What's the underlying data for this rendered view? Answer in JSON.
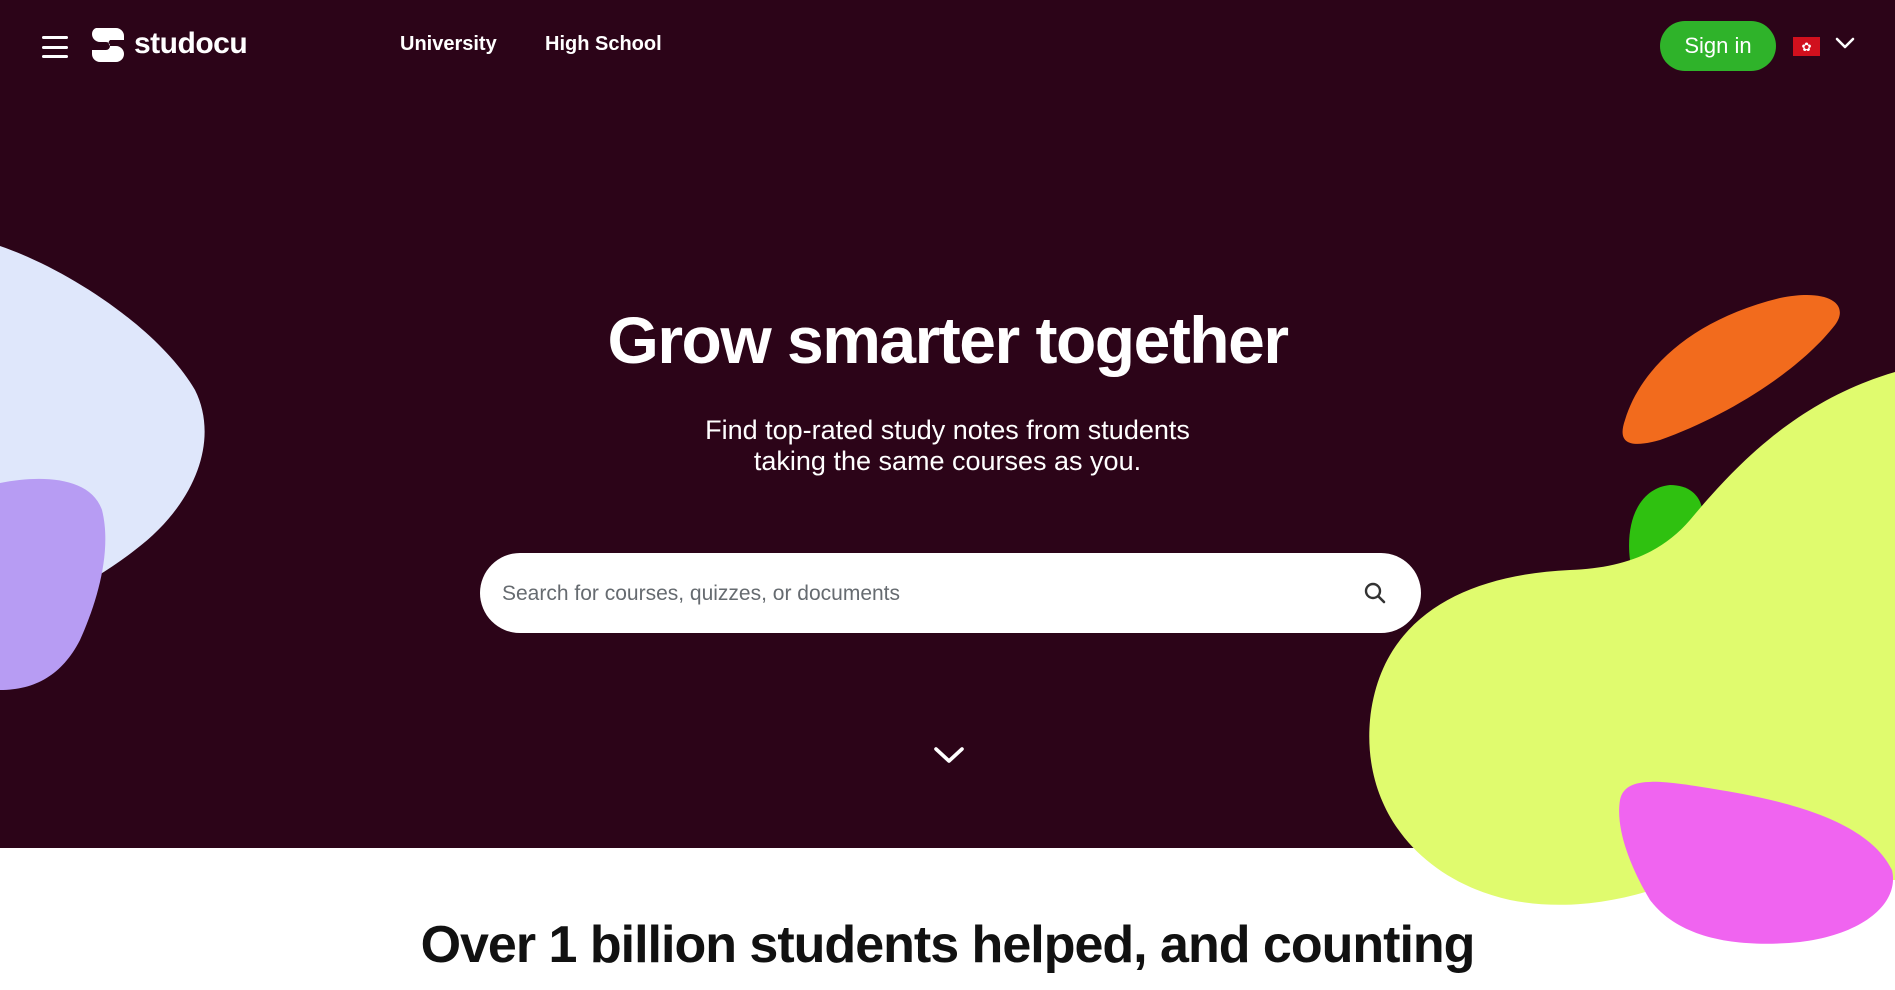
{
  "brand": {
    "name": "studocu"
  },
  "nav": {
    "links": [
      "University",
      "High School"
    ],
    "signin_label": "Sign in",
    "language_flag": "🇭🇰",
    "flag_star": "✿"
  },
  "hero": {
    "headline": "Grow smarter together",
    "subtitle_line1": "Find top-rated study notes from students",
    "subtitle_line2": "taking the same courses as you."
  },
  "search": {
    "placeholder": "Search for courses, quizzes, or documents",
    "value": ""
  },
  "section": {
    "heading": "Over 1 billion students helped, and counting"
  },
  "icons": [
    "menu-icon",
    "studocu-logo-icon",
    "chevron-down-icon",
    "search-icon",
    "scroll-down-chevron-icon"
  ],
  "colors": {
    "hero_background": "#2c0418",
    "signin_green": "#2fb32a",
    "blob_light_blue": "#dfe7fb",
    "blob_lavender": "#b79cf3",
    "blob_orange": "#f26b1d",
    "blob_green": "#2fc110",
    "blob_lime": "#e0fb6e",
    "blob_pink": "#f064f0"
  }
}
